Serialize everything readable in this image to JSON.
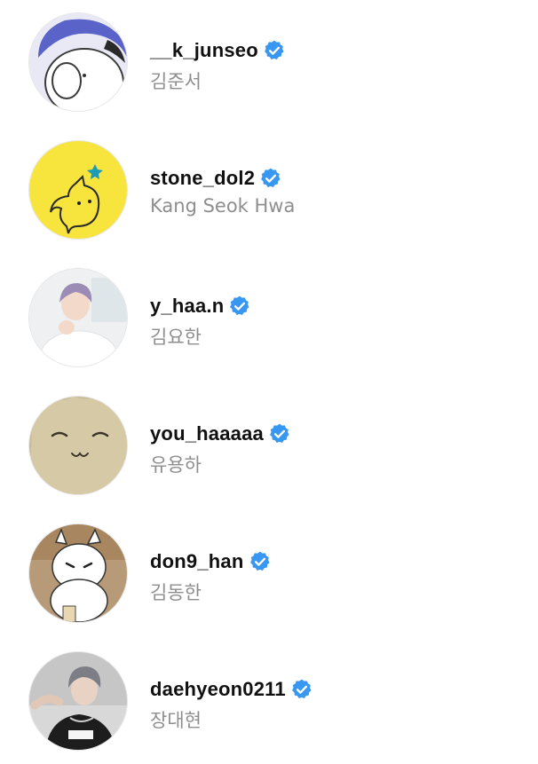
{
  "accounts": [
    {
      "username": "__k_junseo",
      "full_name": "김준서",
      "verified": true,
      "avatar": "cartoon-white-character-blue-hat"
    },
    {
      "username": "stone_dol2",
      "full_name": "Kang Seok Hwa",
      "verified": true,
      "avatar": "yellow-doodle-character"
    },
    {
      "username": "y_haa.n",
      "full_name": "김요한",
      "verified": true,
      "avatar": "person-photo-white-sweater"
    },
    {
      "username": "you_haaaaa",
      "full_name": "유용하",
      "verified": true,
      "avatar": "smiling-beige-creature"
    },
    {
      "username": "don9_han",
      "full_name": "김동한",
      "verified": true,
      "avatar": "moomin-character"
    },
    {
      "username": "daehyeon0211",
      "full_name": "장대현",
      "verified": true,
      "avatar": "person-photo-black-tshirt"
    }
  ],
  "colors": {
    "verified_badge": "#3897f0",
    "username_text": "#111111",
    "full_name_text": "#8e8e8e",
    "background": "#ffffff"
  }
}
